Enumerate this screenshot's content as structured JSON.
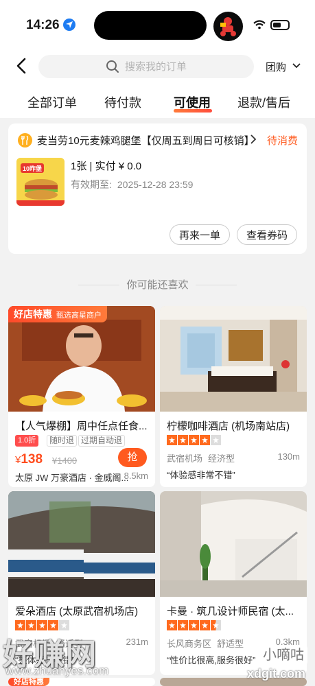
{
  "status_bar": {
    "time": "14:26"
  },
  "header": {
    "search_placeholder": "搜索我的订单",
    "group_label": "团购"
  },
  "tabs": [
    "全部订单",
    "待付款",
    "可使用",
    "退款/售后"
  ],
  "order": {
    "title": "麦当劳10元麦辣鸡腿堡【仅周五到周日可核销】",
    "status": "待消费",
    "qty_line": "1张 | 实付 ¥ 0.0",
    "valid_label": "有效期至:",
    "valid_date": "2025-12-28 23:59",
    "btn_reorder": "再来一单",
    "btn_view_code": "查看券码",
    "thumb_text": "10昨堡"
  },
  "recommend": {
    "title": "你可能还喜欢"
  },
  "cards": [
    {
      "badge": "好店特惠",
      "badge_sub": "甄选高星商户",
      "title": "【人气爆棚】周中任点任食...",
      "discount": "1.0折",
      "tag1": "随时退",
      "tag2": "过期自动退",
      "price": "138",
      "orig_price": "¥1400",
      "grab": "抢",
      "location": "太原 JW 万豪酒店 · 金威阁...",
      "distance": "8.5km"
    },
    {
      "title": "柠檬咖啡酒店 (机场南站店)",
      "rating": 4,
      "area": "武宿机场",
      "type": "经济型",
      "distance": "130m",
      "quote": "“体验感非常不错”"
    },
    {
      "title": "爱朵酒店 (太原武宿机场店)",
      "rating": 4,
      "area": "武宿机场",
      "type": "舒适型",
      "distance": "231m",
      "quote": "“整体感觉不错”"
    },
    {
      "title": "卡曼 · 筑几设计师民宿 (太...",
      "rating": 4.5,
      "area": "长风商务区",
      "type": "舒适型",
      "distance": "0.3km",
      "quote": "“性价比很高,服务很好”"
    },
    {
      "badge": "好店特惠"
    }
  ],
  "watermarks": {
    "wm1": "好赚网",
    "wm2": "www.zhuanyes.com",
    "wm3": "小嘀咕",
    "wm4": "xdgit.com"
  }
}
